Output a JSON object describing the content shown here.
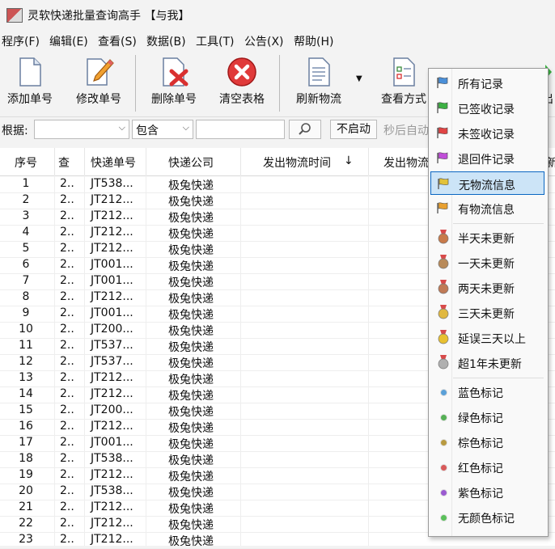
{
  "window": {
    "title": "灵软快递批量查询高手 【与我】"
  },
  "menu": [
    "程序(F)",
    "编辑(E)",
    "查看(S)",
    "数据(B)",
    "工具(T)",
    "公告(X)",
    "帮助(H)"
  ],
  "toolbar": {
    "add": "添加单号",
    "edit": "修改单号",
    "delete": "删除单号",
    "clear": "清空表格",
    "refresh": "刷新物流",
    "view_mode": "查看方式",
    "export_partial": "出"
  },
  "filter": {
    "basis_label": "根据:",
    "field_value": "",
    "match_value": "包含",
    "keyword_value": "",
    "auto_button": "不启动",
    "auto_hint": "秒后自动"
  },
  "table": {
    "headers": [
      "序号",
      "查",
      "快递单号",
      "快递公司",
      "发出物流时间",
      "发出物流",
      "新"
    ],
    "sort_indicator": "↓",
    "rows": [
      {
        "n": "1",
        "s": "2..",
        "no": "JT538...",
        "co": "极兔快递"
      },
      {
        "n": "2",
        "s": "2..",
        "no": "JT212...",
        "co": "极兔快递"
      },
      {
        "n": "3",
        "s": "2..",
        "no": "JT212...",
        "co": "极兔快递"
      },
      {
        "n": "4",
        "s": "2..",
        "no": "JT212...",
        "co": "极兔快递"
      },
      {
        "n": "5",
        "s": "2..",
        "no": "JT212...",
        "co": "极兔快递"
      },
      {
        "n": "6",
        "s": "2..",
        "no": "JT001...",
        "co": "极兔快递"
      },
      {
        "n": "7",
        "s": "2..",
        "no": "JT001...",
        "co": "极兔快递"
      },
      {
        "n": "8",
        "s": "2..",
        "no": "JT212...",
        "co": "极兔快递"
      },
      {
        "n": "9",
        "s": "2..",
        "no": "JT001...",
        "co": "极兔快递"
      },
      {
        "n": "10",
        "s": "2..",
        "no": "JT200...",
        "co": "极兔快递"
      },
      {
        "n": "11",
        "s": "2..",
        "no": "JT537...",
        "co": "极兔快递"
      },
      {
        "n": "12",
        "s": "2..",
        "no": "JT537...",
        "co": "极兔快递"
      },
      {
        "n": "13",
        "s": "2..",
        "no": "JT212...",
        "co": "极兔快递"
      },
      {
        "n": "14",
        "s": "2..",
        "no": "JT212...",
        "co": "极兔快递"
      },
      {
        "n": "15",
        "s": "2..",
        "no": "JT200...",
        "co": "极兔快递"
      },
      {
        "n": "16",
        "s": "2..",
        "no": "JT212...",
        "co": "极兔快递"
      },
      {
        "n": "17",
        "s": "2..",
        "no": "JT001...",
        "co": "极兔快递"
      },
      {
        "n": "18",
        "s": "2..",
        "no": "JT538...",
        "co": "极兔快递"
      },
      {
        "n": "19",
        "s": "2..",
        "no": "JT212...",
        "co": "极兔快递"
      },
      {
        "n": "20",
        "s": "2..",
        "no": "JT538...",
        "co": "极兔快递"
      },
      {
        "n": "21",
        "s": "2..",
        "no": "JT212...",
        "co": "极兔快递"
      },
      {
        "n": "22",
        "s": "2..",
        "no": "JT212...",
        "co": "极兔快递"
      },
      {
        "n": "23",
        "s": "2..",
        "no": "JT212...",
        "co": "极兔快递"
      }
    ]
  },
  "popup": {
    "items": [
      {
        "label": "所有记录",
        "icon": "flag-icon",
        "color": "#4a8fd8"
      },
      {
        "label": "已签收记录",
        "icon": "flag-icon",
        "color": "#3cb043"
      },
      {
        "label": "未签收记录",
        "icon": "flag-icon",
        "color": "#e04444"
      },
      {
        "label": "退回件记录",
        "icon": "flag-icon",
        "color": "#c04ed8"
      },
      {
        "label": "无物流信息",
        "icon": "flag-icon",
        "color": "#e2c23a",
        "selected": true
      },
      {
        "label": "有物流信息",
        "icon": "flag-icon",
        "color": "#e8a030"
      },
      {
        "label": "半天未更新",
        "icon": "medal-icon",
        "color": "#c87a4a"
      },
      {
        "label": "一天未更新",
        "icon": "medal-icon",
        "color": "#b88a5a"
      },
      {
        "label": "两天未更新",
        "icon": "medal-icon",
        "color": "#c07a56"
      },
      {
        "label": "三天未更新",
        "icon": "medal-icon",
        "color": "#e0b840"
      },
      {
        "label": "延误三天以上",
        "icon": "medal-icon",
        "color": "#e8c030"
      },
      {
        "label": "超1年未更新",
        "icon": "medal-icon",
        "color": "#b0b0b0"
      },
      {
        "label": "蓝色标记",
        "icon": "dot-icon",
        "color": "#5aa0d8"
      },
      {
        "label": "绿色标记",
        "icon": "dot-icon",
        "color": "#55b055"
      },
      {
        "label": "棕色标记",
        "icon": "dot-icon",
        "color": "#b89a40"
      },
      {
        "label": "红色标记",
        "icon": "dot-icon",
        "color": "#d85a5a"
      },
      {
        "label": "紫色标记",
        "icon": "dot-icon",
        "color": "#9a5ad0"
      },
      {
        "label": "无颜色标记",
        "icon": "dot-icon",
        "color": "#5ac05a"
      }
    ]
  }
}
